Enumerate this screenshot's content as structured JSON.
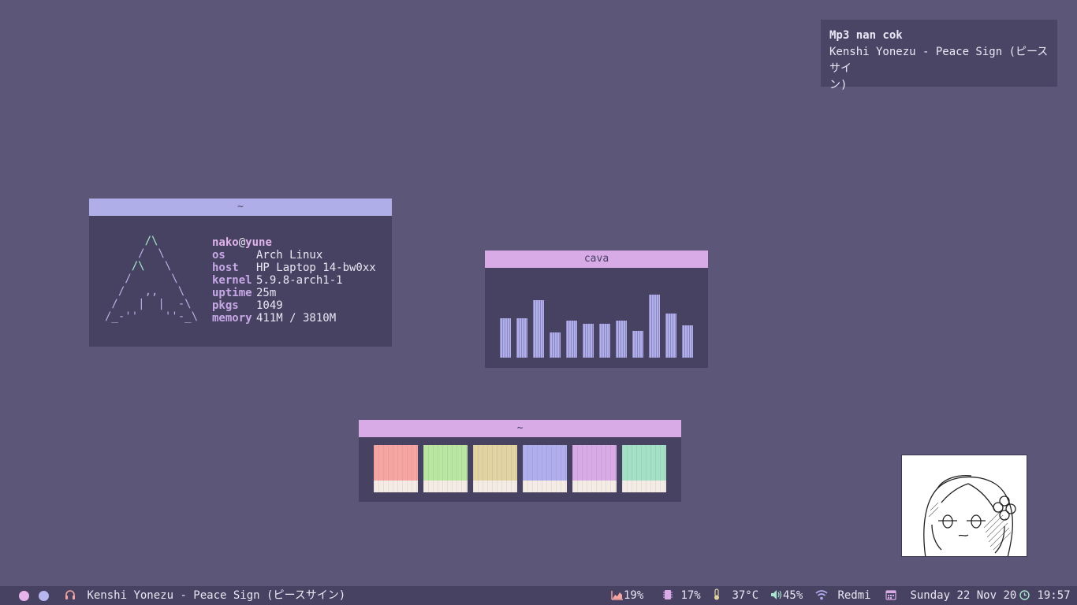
{
  "notification": {
    "summary": "Mp3 nan cok",
    "body_line1": "Kenshi Yonezu - Peace Sign (ピースサイ",
    "body_line2": "ン)"
  },
  "fetch_window": {
    "title": "~",
    "user": "nako",
    "at": "@",
    "host_name": "yune",
    "rows": [
      {
        "key": "os",
        "value": "Arch Linux"
      },
      {
        "key": "host",
        "value": "HP Laptop 14-bw0xx"
      },
      {
        "key": "kernel",
        "value": "5.9.8-arch1-1"
      },
      {
        "key": "uptime",
        "value": "25m"
      },
      {
        "key": "pkgs",
        "value": "1049"
      },
      {
        "key": "memory",
        "value": "411M / 3810M"
      }
    ]
  },
  "cava_window": {
    "title": "cava",
    "bar_levels": [
      0.5,
      0.5,
      0.73,
      0.32,
      0.47,
      0.43,
      0.43,
      0.47,
      0.34,
      0.8,
      0.56,
      0.41
    ]
  },
  "colors_window": {
    "title": "~",
    "swatches": [
      "#f7a5a3",
      "#b9e6a1",
      "#e2d3a3",
      "#b0aeec",
      "#d8aae6",
      "#a4e0c5"
    ]
  },
  "panel": {
    "workspace_colors": [
      "#e6b4ea",
      "#b8b6f0"
    ],
    "now_playing": "Kenshi Yonezu - Peace Sign (ピースサイン)",
    "cpu": "19%",
    "memory": "17%",
    "temperature": "37°C",
    "volume": "45%",
    "wifi": "Redmi",
    "date": "Sunday 22 Nov 20",
    "time": "19:57"
  },
  "colors": {
    "desktop_bg": "#5c5779",
    "window_bg": "#474262",
    "accent_blue": "#b0aee8",
    "accent_pink": "#d8aae6",
    "accent_red": "#f7a5a3",
    "accent_green": "#a8e6cf"
  }
}
